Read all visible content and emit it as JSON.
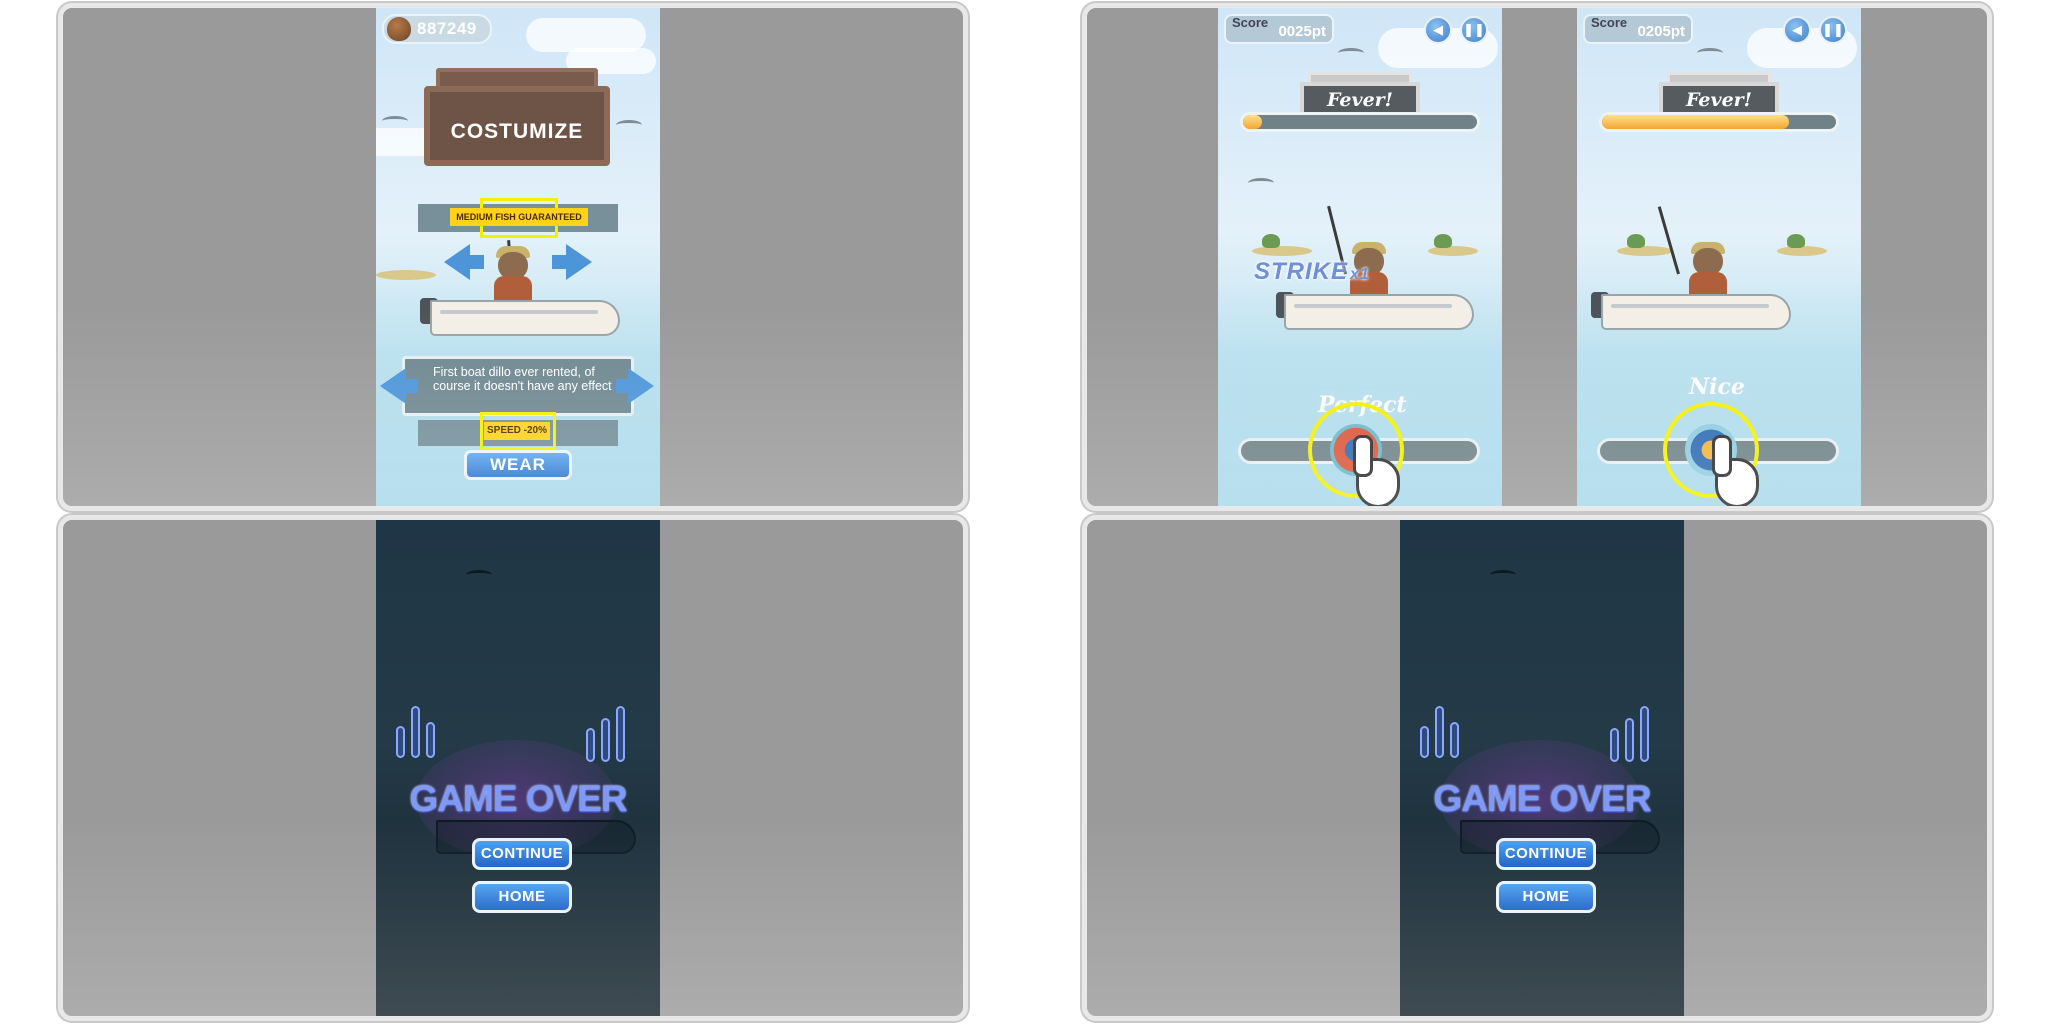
{
  "customize": {
    "acorns": "887249",
    "title": "COSTUMIZE",
    "perk": "MEDIUM FISH GUARANTEED",
    "description": "First boat dillo ever rented, of course it doesn't have any effect",
    "stat": "SPEED -20%",
    "wear_label": "WEAR"
  },
  "gameplay": [
    {
      "score_label": "Score",
      "score": "0025pt",
      "fever": "Fever!",
      "fever_progress": 0.08,
      "strike": "STRIKE",
      "strike_mult": "x1",
      "judgement": "Perfect"
    },
    {
      "score_label": "Score",
      "score": "0205pt",
      "fever": "Fever!",
      "fever_progress": 0.8,
      "judgement": "Nice"
    }
  ],
  "game_over": [
    {
      "title": "GAME OVER",
      "continue_label": "CONTINUE",
      "home_label": "HOME"
    },
    {
      "title": "GAME OVER",
      "continue_label": "CONTINUE",
      "home_label": "HOME"
    }
  ],
  "icons": {
    "acorn": "acorn-icon",
    "sound": "speaker-icon",
    "pause": "pause-icon",
    "arrow_left": "arrow-left-icon",
    "arrow_right": "arrow-right-icon",
    "hand": "pointing-hand-icon"
  },
  "colors": {
    "highlight": "#f4f000",
    "button_blue": "#2e74cf",
    "game_over_text": "#7f9af6",
    "fever_fill": "#f4a633"
  }
}
